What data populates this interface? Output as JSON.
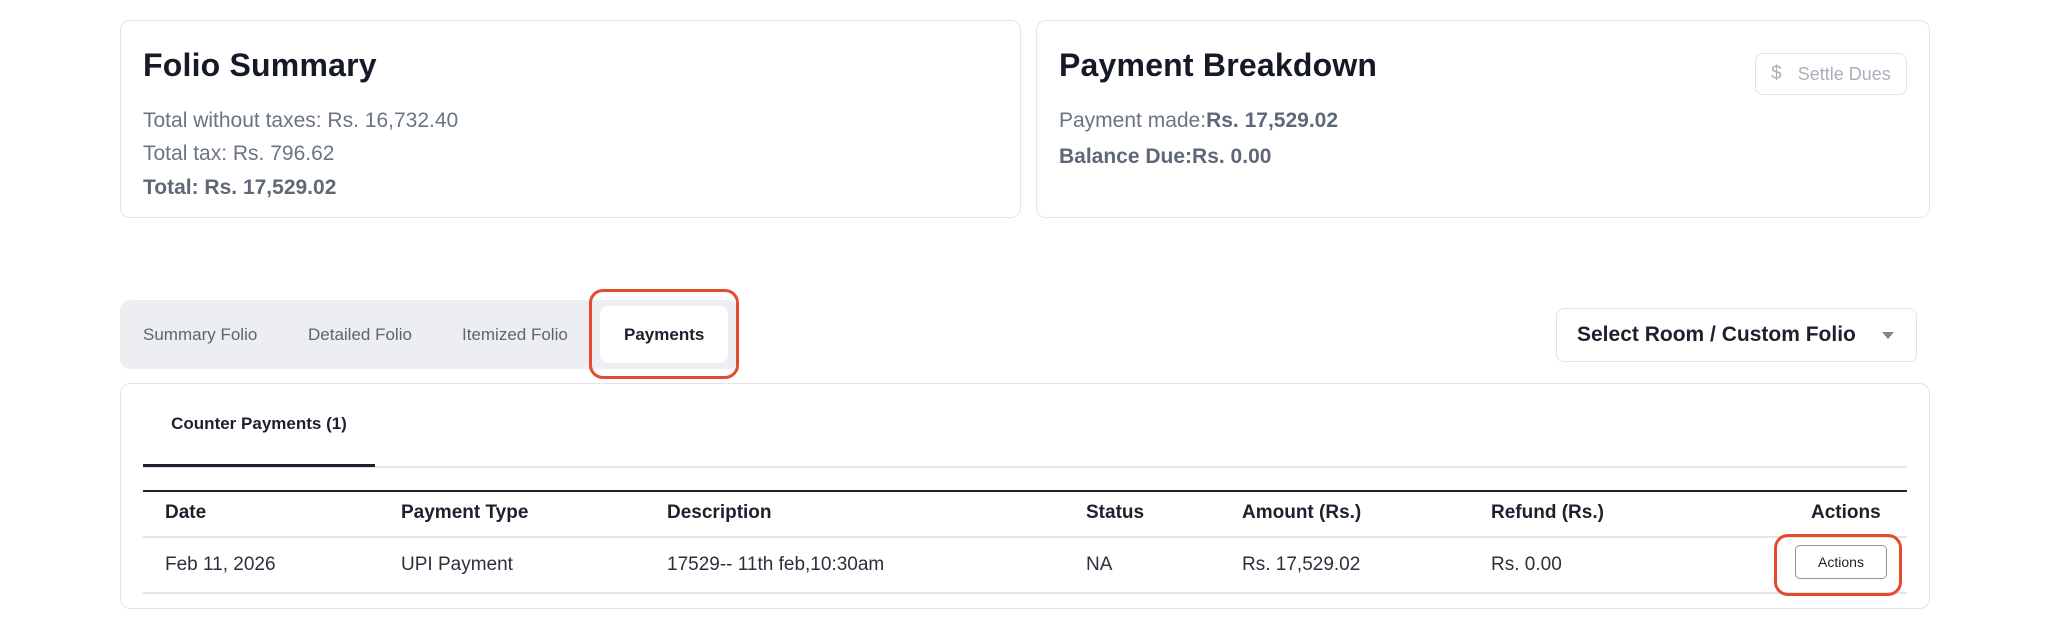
{
  "folio_summary": {
    "title": "Folio Summary",
    "total_without_taxes": "Total without taxes: Rs. 16,732.40",
    "total_tax": "Total tax: Rs. 796.62",
    "total": "Total: Rs. 17,529.02"
  },
  "payment_breakdown": {
    "title": "Payment Breakdown",
    "payment_made_label": "Payment made:",
    "payment_made_value": "Rs. 17,529.02",
    "balance_due_label": "Balance Due:",
    "balance_due_value": "Rs. 0.00",
    "settle_icon": "$",
    "settle_label": "Settle Dues"
  },
  "tabs": [
    {
      "label": "Summary Folio",
      "active": false
    },
    {
      "label": "Detailed Folio",
      "active": false
    },
    {
      "label": "Itemized Folio",
      "active": false
    },
    {
      "label": "Payments",
      "active": true
    }
  ],
  "select_room": {
    "label": "Select Room / Custom Folio"
  },
  "payments_panel": {
    "subtab": "Counter Payments (1)",
    "columns": [
      "Date",
      "Payment Type",
      "Description",
      "Status",
      "Amount (Rs.)",
      "Refund (Rs.)",
      "Actions"
    ],
    "rows": [
      {
        "date": "Feb 11, 2026",
        "payment_type": "UPI Payment",
        "description": "17529-- 11th feb,10:30am",
        "status": "NA",
        "amount": "Rs. 17,529.02",
        "refund": "Rs. 0.00",
        "action_label": "Actions"
      }
    ]
  },
  "colors": {
    "highlight": "#e54a2c",
    "tab_bar_bg": "#eceef1",
    "muted_text": "#6b7482"
  }
}
